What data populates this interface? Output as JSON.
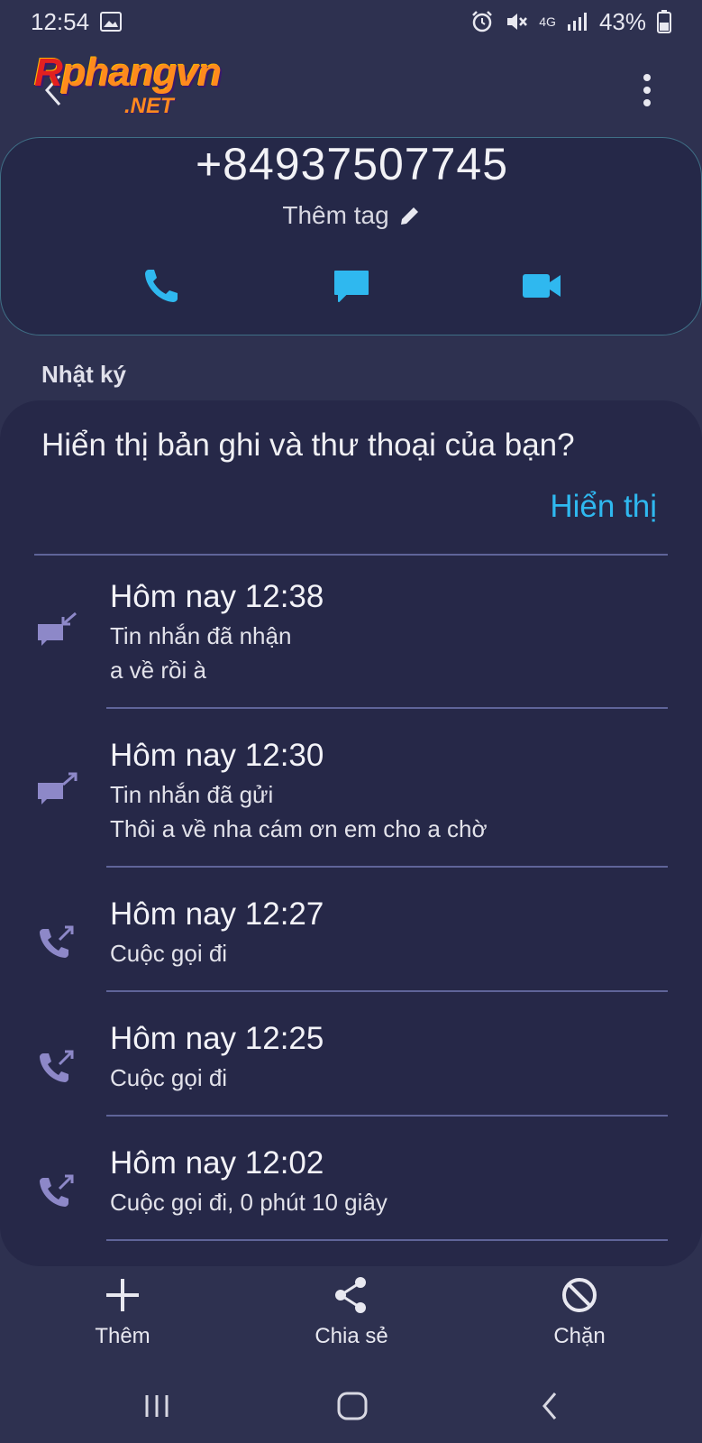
{
  "status_bar": {
    "time": "12:54",
    "network_type": "4G",
    "battery_percent": "43%",
    "icons": [
      "gallery-icon",
      "alarm-icon",
      "mute-icon",
      "network-4g-icon",
      "signal-icon",
      "battery-icon"
    ]
  },
  "header": {
    "logo_text": "phangvn",
    "logo_initial": "R",
    "logo_suffix": ".NET"
  },
  "contact": {
    "phone_number": "+84937507745",
    "add_tag_label": "Thêm tag"
  },
  "log_section": {
    "title": "Nhật ký",
    "prompt": "Hiển thị bản ghi và thư thoại của bạn?",
    "show_link": "Hiển thị",
    "entries": [
      {
        "time": "Hôm nay 12:38",
        "type": "Tin nhắn đã nhận",
        "message": "a về rồi à",
        "icon": "message-received-icon"
      },
      {
        "time": "Hôm nay 12:30",
        "type": "Tin nhắn đã gửi",
        "message": "Thôi a về nha cám ơn em cho a chờ",
        "icon": "message-sent-icon"
      },
      {
        "time": "Hôm nay 12:27",
        "type": "Cuộc gọi đi",
        "message": "",
        "icon": "outgoing-call-icon"
      },
      {
        "time": "Hôm nay 12:25",
        "type": "Cuộc gọi đi",
        "message": "",
        "icon": "outgoing-call-icon"
      },
      {
        "time": "Hôm nay 12:02",
        "type": "Cuộc gọi đi, 0 phút 10 giây",
        "message": "",
        "icon": "outgoing-call-icon"
      }
    ]
  },
  "bottom_actions": {
    "add_label": "Thêm",
    "share_label": "Chia sẻ",
    "block_label": "Chặn"
  },
  "colors": {
    "background": "#2e3150",
    "card": "#262848",
    "accent": "#2fb8ef",
    "log_icon": "#8d88c8",
    "divider": "#5f6499"
  }
}
